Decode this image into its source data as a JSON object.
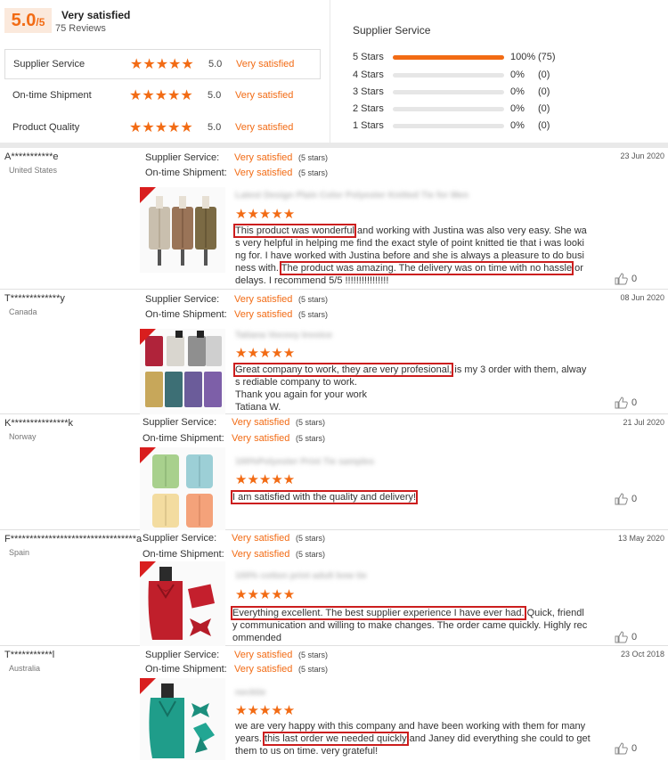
{
  "summary": {
    "score": "5.0",
    "score_denominator": "/5",
    "overall_label": "Very satisfied",
    "review_count": "75 Reviews",
    "metrics": [
      {
        "name": "Supplier Service",
        "score": "5.0",
        "label": "Very satisfied"
      },
      {
        "name": "On-time Shipment",
        "score": "5.0",
        "label": "Very satisfied"
      },
      {
        "name": "Product Quality",
        "score": "5.0",
        "label": "Very satisfied"
      }
    ],
    "star_glyphs": "★★★★★"
  },
  "distribution": {
    "title": "Supplier Service",
    "rows": [
      {
        "label": "5 Stars",
        "percent": "100%",
        "count": "(75)",
        "fill": 1.0
      },
      {
        "label": "4 Stars",
        "percent": "0%",
        "count": "(0)",
        "fill": 0.0
      },
      {
        "label": "3 Stars",
        "percent": "0%",
        "count": "(0)",
        "fill": 0.0
      },
      {
        "label": "2 Stars",
        "percent": "0%",
        "count": "(0)",
        "fill": 0.0
      },
      {
        "label": "1 Stars",
        "percent": "0%",
        "count": "(0)",
        "fill": 0.0
      }
    ]
  },
  "rating_labels": {
    "supplier_service": "Supplier Service:",
    "on_time_shipment": "On-time Shipment:",
    "value": "Very satisfied",
    "stars": "(5 stars)"
  },
  "colors": {
    "accent": "#f26b14",
    "highlight_box": "#cc1e1e"
  },
  "reviews": [
    {
      "buyer": "A***********e",
      "country": "United States",
      "date": "23 Jun 2020",
      "product_title": "Latest Design Plain Color Polyester Knitted Tie for Men",
      "text_highlight_1": "This product was wonderful",
      "text_part_2": " and working with Justina was also very easy. She was very helpful in helping me find the exact style of point knitted tie that i was looking for. I have worked with Justina before and she is always a pleasure to do business with.",
      "text_highlight_2": "The product was amazing. The delivery was on time with no hassle",
      "text_part_3": " or delays. I recommend 5/5 !!!!!!!!!!!!!!!!",
      "likes": "0"
    },
    {
      "buyer": "T*************y",
      "country": "Canada",
      "date": "08 Jun 2020",
      "product_title": "Tatiana Vocovy Invoice",
      "text_highlight_1": "Great company to work, they are very profesional,",
      "text_part_2": " is my 3 order with them, always rediable company to work.",
      "text_line_3": "Thank you again for your work",
      "text_line_4": "Tatiana W.",
      "likes": "0"
    },
    {
      "buyer": "K***************k",
      "country": "Norway",
      "date": "21 Jul 2020",
      "product_title": "100%Polyester Print Tie samples",
      "text_highlight_1": "I am satisfied with the quality and delivery!",
      "likes": "0"
    },
    {
      "buyer": "F*********************************a",
      "country": "Spain",
      "date": "13 May 2020",
      "product_title": "100% cotton print adult bow tie",
      "text_highlight_1": "Everything excellent. The best supplier experience I have ever had.",
      "text_part_2": " Quick, friendly communication and willing to make changes. The order came quickly. Highly recommended",
      "likes": "0"
    },
    {
      "buyer": "T***********l",
      "country": "Australia",
      "date": "23 Oct 2018",
      "product_title": "necktie",
      "text_part_1": "we are very happy with this company and have been working with them for many years.",
      "text_highlight_1": "this last order we needed quickly",
      "text_part_2": " and Janey did everything she could to get them to us on time.  very grateful!",
      "likes": "0"
    }
  ]
}
